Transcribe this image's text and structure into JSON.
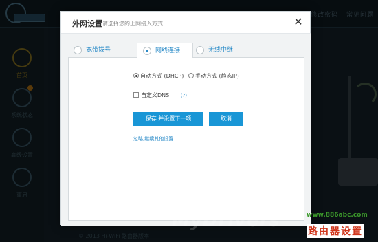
{
  "background": {
    "top_links": "修改密码 | 常见问题",
    "sidebar": [
      {
        "label": "首页",
        "icon": "home-icon",
        "active": true
      },
      {
        "label": "系统状态",
        "icon": "pulse-icon",
        "active": false
      },
      {
        "label": "高级设置",
        "icon": "gear-icon",
        "active": false
      },
      {
        "label": "重启",
        "icon": "power-icon",
        "active": false
      }
    ],
    "footer": "© 2013 Hi-WiFi 路由器版本"
  },
  "dialog": {
    "title": "外网设置",
    "subtitle": "请选择您的上网接入方式",
    "close_glyph": "✕",
    "tabs": [
      {
        "label": "宽带拨号",
        "active": false
      },
      {
        "label": "网线连接",
        "active": true
      },
      {
        "label": "无线中继",
        "active": false
      }
    ],
    "modes": {
      "dhcp_label": "自动方式 (DHCP)",
      "dhcp_selected": true,
      "static_label": "手动方式 (静态IP)",
      "static_selected": false
    },
    "dns": {
      "label": "自定义DNS",
      "checked": false,
      "help": "(?)"
    },
    "save_button": "保存 并设置下一项",
    "cancel_button": "取消",
    "skip_link": "忽略,继续其他设置"
  },
  "overlay_text": {
    "watermark": "MyDrivers",
    "site_url": "www.886abc.com",
    "site_name": "路由器设置"
  },
  "colors": {
    "accent": "#1996d6",
    "link": "#2a8bc8",
    "site_url": "#3c9a2b",
    "site_name": "#d0361c"
  }
}
